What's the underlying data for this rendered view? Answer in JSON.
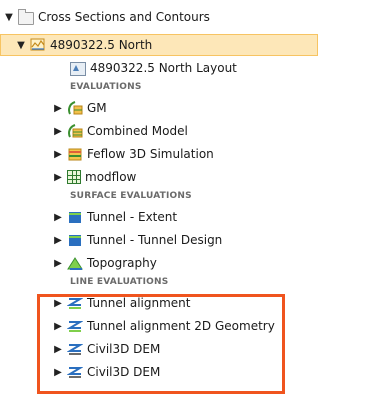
{
  "tree": {
    "root": {
      "label": "Cross Sections and Contours",
      "icon": "folder-icon"
    },
    "selected": {
      "label": "4890322.5 North",
      "icon": "cross-section-icon"
    },
    "layout_item": {
      "label": "4890322.5 North Layout",
      "icon": "layout-icon"
    },
    "sections": {
      "evaluations": "EVALUATIONS",
      "surface_evaluations": "SURFACE EVALUATIONS",
      "line_evaluations": "LINE EVALUATIONS"
    },
    "evaluations": [
      {
        "label": "GM",
        "icon": "model-icon"
      },
      {
        "label": "Combined Model",
        "icon": "model-icon"
      },
      {
        "label": "Feflow 3D Simulation",
        "icon": "feflow-icon"
      },
      {
        "label": "modflow",
        "icon": "grid-icon"
      }
    ],
    "surface_evaluations": [
      {
        "label": "Tunnel - Extent",
        "icon": "surface-icon"
      },
      {
        "label": "Tunnel - Tunnel Design",
        "icon": "surface-icon"
      },
      {
        "label": "Topography",
        "icon": "surface-icon"
      }
    ],
    "line_evaluations": [
      {
        "label": "Tunnel alignment",
        "icon": "line-icon"
      },
      {
        "label": "Tunnel alignment 2D Geometry",
        "icon": "line-icon"
      },
      {
        "label": "Civil3D DEM",
        "icon": "line-icon"
      },
      {
        "label": "Civil3D DEM",
        "icon": "line-icon"
      }
    ]
  },
  "colors": {
    "selection_bg": "#fde7b8",
    "selection_border": "#f7c462",
    "highlight_border": "#f0541e",
    "section_text": "#6a6a6a"
  }
}
